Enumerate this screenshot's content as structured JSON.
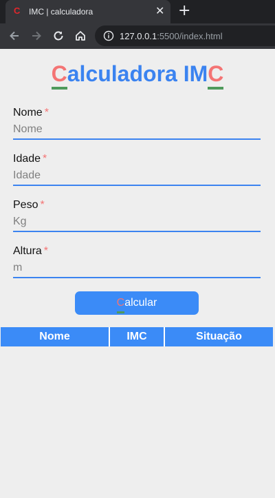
{
  "browser": {
    "tab_favicon": "C",
    "tab_title": "IMC | calculadora",
    "url_host": "127.0.0.1",
    "url_rest": ":5500/index.html"
  },
  "page": {
    "title_first": "C",
    "title_middle": "alculadora IM",
    "title_last": "C",
    "fields": [
      {
        "label": "Nome",
        "required_mark": "*",
        "placeholder": "Nome"
      },
      {
        "label": "Idade",
        "required_mark": "*",
        "placeholder": "Idade"
      },
      {
        "label": "Peso",
        "required_mark": "*",
        "placeholder": "Kg"
      },
      {
        "label": "Altura",
        "required_mark": "*",
        "placeholder": "m"
      }
    ],
    "button_first": "C",
    "button_rest": "alcular",
    "table_headers": [
      "Nome",
      "IMC",
      "Situação"
    ]
  },
  "colors": {
    "accent": "#3b83f0",
    "highlight": "#f47474",
    "underline": "#4e9a5b",
    "background": "#eeeeee"
  }
}
